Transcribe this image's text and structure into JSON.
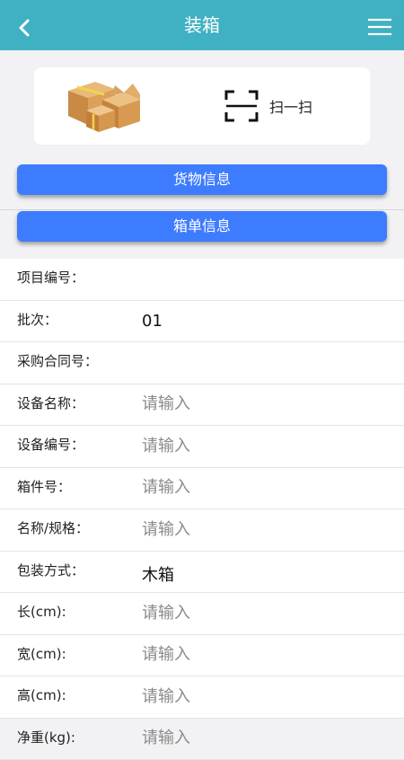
{
  "header": {
    "title": "装箱",
    "back_icon": "chevron-left-icon",
    "menu_icon": "hamburger-menu-icon",
    "bg_color": "#3fb1c2"
  },
  "scan_card": {
    "image": "cardboard-boxes-illustration",
    "scan_icon": "scan-frame-icon",
    "scan_label": "扫一扫"
  },
  "buttons": {
    "goods_info": "货物信息",
    "box_info": "箱单信息",
    "color": "#3e7cff"
  },
  "form": {
    "rows": [
      {
        "label": "项目编号：",
        "value": "",
        "placeholder": ""
      },
      {
        "label": "批次：",
        "value": "01",
        "placeholder": ""
      },
      {
        "label": "采购合同号：",
        "value": "",
        "placeholder": ""
      },
      {
        "label": "设备名称：",
        "value": "",
        "placeholder": "请输入"
      },
      {
        "label": "设备编号：",
        "value": "",
        "placeholder": "请输入"
      },
      {
        "label": "箱件号：",
        "value": "",
        "placeholder": "请输入"
      },
      {
        "label": "名称/规格：",
        "value": "",
        "placeholder": "请输入"
      },
      {
        "label": "包装方式：",
        "value": "木箱",
        "placeholder": ""
      },
      {
        "label": "长(cm):",
        "value": "",
        "placeholder": "请输入"
      },
      {
        "label": "宽(cm):",
        "value": "",
        "placeholder": "请输入"
      },
      {
        "label": "高(cm):",
        "value": "",
        "placeholder": "请输入"
      },
      {
        "label": "净重(kg):",
        "value": "",
        "placeholder": "请输入"
      }
    ]
  }
}
